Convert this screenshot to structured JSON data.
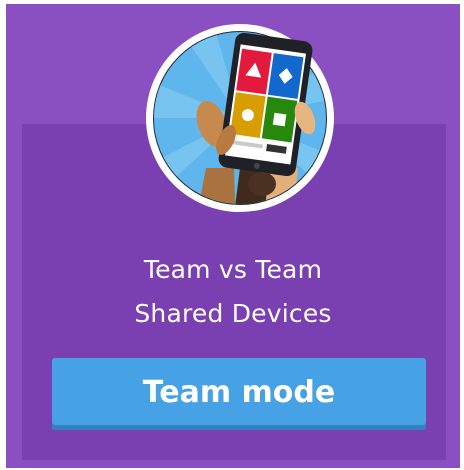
{
  "card": {
    "line1": "Team vs Team",
    "line2": "Shared Devices",
    "button_label": "Team mode"
  },
  "icons": {
    "illustration": "hands-holding-phone-icon",
    "tiles": [
      "triangle-tile",
      "diamond-tile",
      "circle-tile",
      "square-tile"
    ]
  },
  "colors": {
    "card_background": "#8a4fc0",
    "inner_panel": "#7a3fb0",
    "button": "#46a1e5",
    "tile_red": "#e21b3c",
    "tile_blue": "#1368ce",
    "tile_yellow": "#d89e00",
    "tile_green": "#26890c"
  }
}
